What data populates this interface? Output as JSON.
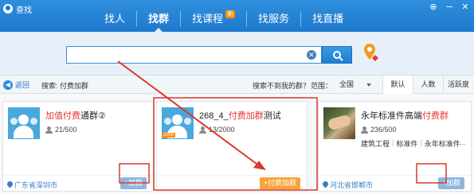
{
  "app": {
    "title": "查找"
  },
  "window_buttons": [
    "⊕",
    "─",
    "✕"
  ],
  "nav": {
    "items": [
      "找人",
      "找群",
      "找课程",
      "找服务",
      "找直播"
    ],
    "active_index": 1,
    "badge": "新"
  },
  "search": {
    "value": "",
    "placeholder": ""
  },
  "filter": {
    "back_label": "返回",
    "search_label": "搜索: 付费加群",
    "not_found": "搜索不到我的群？",
    "range_label": "范围：",
    "range_value": "全国",
    "sort_tabs": [
      "默认",
      "人数",
      "活跃度"
    ],
    "active_sort": 0
  },
  "cards": [
    {
      "title_parts": [
        "加值",
        "付费",
        "通群②"
      ],
      "members": "21/500",
      "tags": [],
      "location": "广东省深圳市",
      "join_label": "+加群",
      "paid": false
    },
    {
      "title_parts": [
        "268_4_",
        "付费加群",
        "测试"
      ],
      "members": "13/2000",
      "tags": [],
      "location": "",
      "join_label": "+付费加群",
      "paid": true,
      "avatar_tag": "2000"
    },
    {
      "title_parts": [
        "永年标准件高端",
        "付费群",
        ""
      ],
      "members": "236/500",
      "tags": [
        "建筑工程",
        "标准件",
        "永年标准件"
      ],
      "more": "...",
      "location": "河北省邯郸市",
      "join_label": "+加群",
      "paid": false
    }
  ],
  "colors": {
    "titlebar": "#1e79cc",
    "highlight_red": "#e53935",
    "annotation_red": "#d9382c",
    "paid_orange": "#f7a33b",
    "join_blue": "#8db7dd"
  },
  "icons": [
    "app-logo-icon",
    "search-clear-icon",
    "search-icon",
    "map-pin-icon",
    "back-icon",
    "member-icon",
    "location-pin-icon"
  ]
}
